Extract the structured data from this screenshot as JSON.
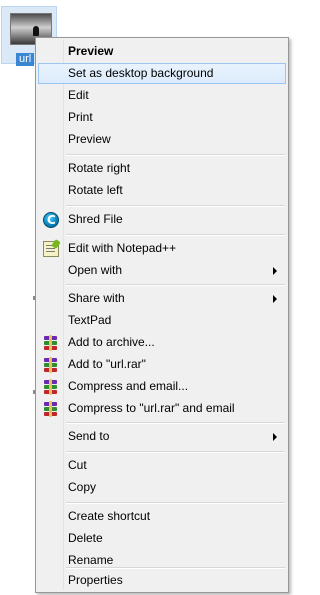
{
  "desktop": {
    "file_label": "url"
  },
  "menu": {
    "items": [
      {
        "label": "Preview",
        "bold": true
      },
      {
        "label": "Set as desktop background",
        "highlighted": true
      },
      {
        "label": "Edit"
      },
      {
        "label": "Print"
      },
      {
        "label": "Preview"
      },
      {
        "label": "Rotate right"
      },
      {
        "label": "Rotate left"
      },
      {
        "label": "Shred File",
        "icon": "shred-icon"
      },
      {
        "label": "Edit with Notepad++",
        "icon": "notepad-plus-plus-icon"
      },
      {
        "label": "Open with",
        "submenu": true
      },
      {
        "label": "Share with",
        "submenu": true
      },
      {
        "label": "TextPad"
      },
      {
        "label": "Add to archive...",
        "icon": "winrar-icon"
      },
      {
        "label": "Add to \"url.rar\"",
        "icon": "winrar-icon"
      },
      {
        "label": "Compress and email...",
        "icon": "winrar-icon"
      },
      {
        "label": "Compress to \"url.rar\" and email",
        "icon": "winrar-icon"
      },
      {
        "label": "Send to",
        "submenu": true
      },
      {
        "label": "Cut"
      },
      {
        "label": "Copy"
      },
      {
        "label": "Create shortcut"
      },
      {
        "label": "Delete"
      },
      {
        "label": "Rename"
      },
      {
        "label": "Properties"
      }
    ]
  },
  "colors": {
    "menu_background": "#f0f0f0",
    "highlight_border": "#9cc6f0",
    "highlight_fill": "#dcebfc"
  }
}
